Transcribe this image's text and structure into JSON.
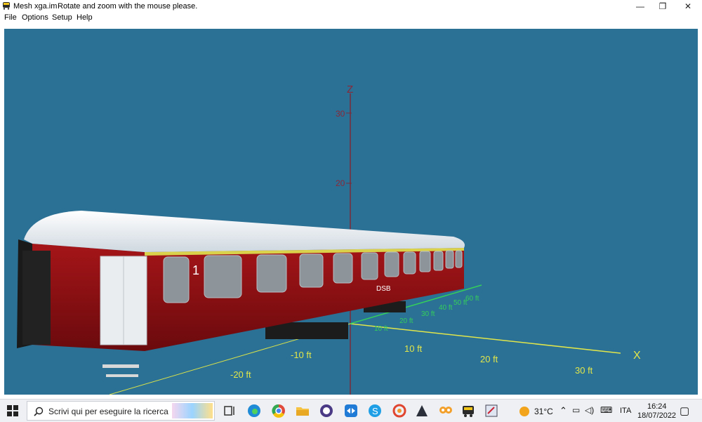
{
  "window": {
    "title": "Mesh xga.im",
    "hint": "Rotate and zoom with the mouse please.",
    "controls": {
      "minimize": "—",
      "restore": "❐",
      "close": "✕"
    }
  },
  "menu": [
    {
      "label": "File"
    },
    {
      "label": "Options"
    },
    {
      "label": "Setup"
    },
    {
      "label": "Help"
    }
  ],
  "scene": {
    "background_color": "#2b7095",
    "axes": {
      "z_label": "Z",
      "x_label": "X",
      "z_ticks": [
        "30",
        "20"
      ],
      "x_ticks": [
        "10 ft",
        "20 ft",
        "30 ft"
      ],
      "neg_ticks": [
        "-10 ft",
        "-20 ft"
      ],
      "y_ticks": [
        "10 ft",
        "20 ft",
        "30 ft",
        "40 ft",
        "50 ft",
        "60 ft"
      ],
      "colors": {
        "z": "#7a2a3a",
        "x": "#e1e64a",
        "y": "#35d05a"
      }
    },
    "carriage": {
      "operator": "DSB",
      "class_number": "1",
      "body_color": "#8e0d12",
      "roof_color": "#eef2f6"
    }
  },
  "taskbar": {
    "search_placeholder": "Scrivi qui per eseguire la ricerca",
    "weather": "31°C",
    "language": "ITA",
    "time": "16:24",
    "date": "18/07/2022",
    "apps": [
      "task-view-icon",
      "edge-icon",
      "chrome-icon",
      "file-explorer-icon",
      "github-icon",
      "teamviewer-icon",
      "skype-icon",
      "app-red-icon",
      "app-dark-icon",
      "app-owl-icon",
      "mesh-viewer-icon",
      "app-paint-icon"
    ]
  }
}
